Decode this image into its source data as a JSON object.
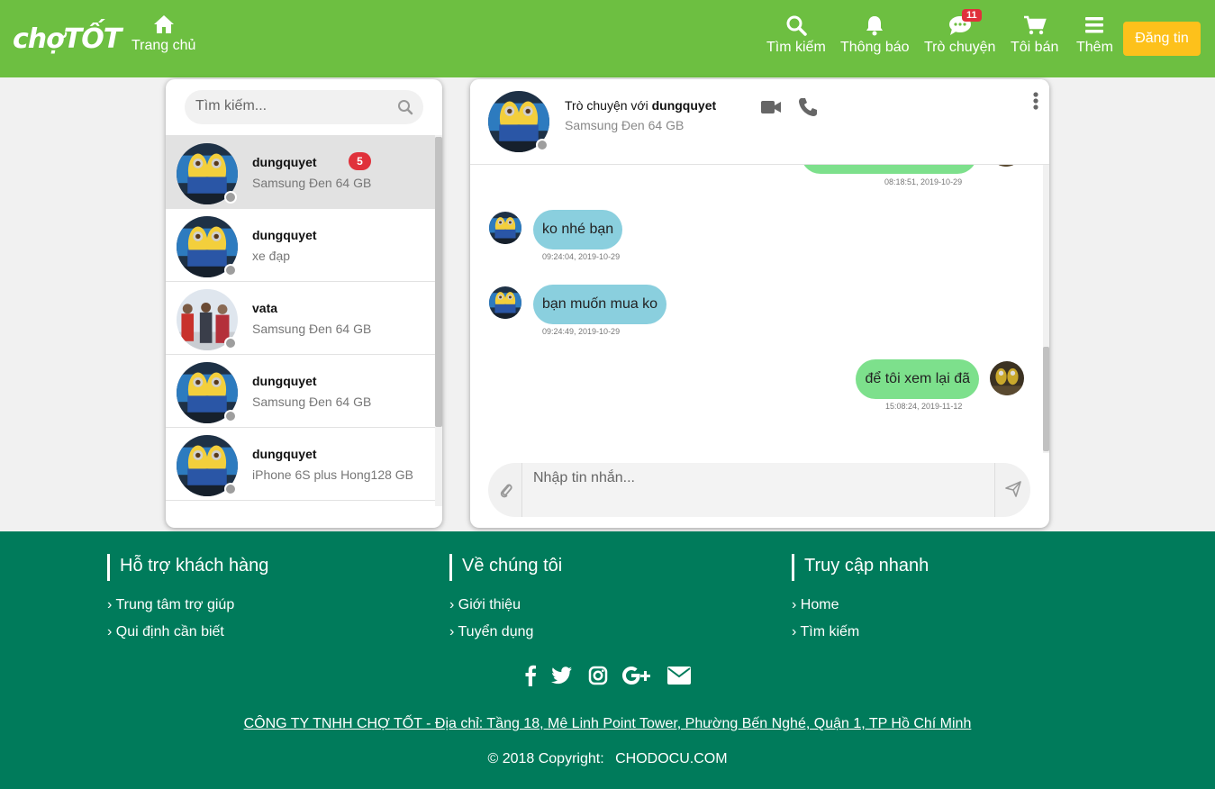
{
  "header": {
    "logo": "chợTỐT",
    "nav": {
      "home": "Trang chủ",
      "search": "Tìm kiếm",
      "notify": "Thông báo",
      "chat": "Trò chuyện",
      "chat_badge": "11",
      "sell": "Tôi bán",
      "more": "Thêm"
    },
    "post_button": "Đăng tin"
  },
  "sidebar": {
    "search_placeholder": "Tìm kiếm...",
    "conversations": [
      {
        "name": "dungquyet",
        "product": "Samsung Đen 64 GB",
        "unread": "5"
      },
      {
        "name": "dungquyet",
        "product": "xe đạp"
      },
      {
        "name": "vata",
        "product": "Samsung Đen 64 GB"
      },
      {
        "name": "dungquyet",
        "product": "Samsung Đen 64 GB"
      },
      {
        "name": "dungquyet",
        "product": "iPhone 6S plus Hong128 GB"
      }
    ]
  },
  "chat": {
    "with_prefix": "Trò chuyện với",
    "with_user": "dungquyet",
    "product": "Samsung Đen 64 GB",
    "messages": [
      {
        "direction": "out",
        "text": "",
        "time": "08:18:51, 2019-10-29"
      },
      {
        "direction": "in",
        "text": "ko nhé bạn",
        "time": "09:24:04, 2019-10-29"
      },
      {
        "direction": "in",
        "text": "bạn muốn mua ko",
        "time": "09:24:49, 2019-10-29"
      },
      {
        "direction": "out",
        "text": "để tôi xem lại đã",
        "time": "15:08:24, 2019-11-12"
      }
    ],
    "input_placeholder": "Nhập tin nhắn..."
  },
  "footer": {
    "columns": [
      {
        "title": "Hỗ trợ khách hàng",
        "links": [
          "Trung tâm trợ giúp",
          "Qui định cần biết"
        ]
      },
      {
        "title": "Về chúng tôi",
        "links": [
          "Giới thiệu",
          "Tuyển dụng"
        ]
      },
      {
        "title": "Truy cập nhanh",
        "links": [
          "Home",
          "Tìm kiếm"
        ]
      }
    ],
    "link_prefix": "›",
    "address": "CÔNG TY TNHH CHỢ TỐT - Địa chỉ: Tầng 18, Mê Linh Point Tower, Phường Bến Nghé, Quận 1, TP Hồ Chí Minh",
    "copyright": "© 2018 Copyright:",
    "brand": "CHODOCU.COM"
  },
  "colors": {
    "header": "#6dbf41",
    "post_button": "#fdc11b",
    "footer": "#007b5b",
    "incoming": "#8acfde",
    "outgoing": "#7de08c",
    "badge": "#e0313b"
  },
  "icons": [
    "home-icon",
    "search-icon",
    "bell-icon",
    "chat-icon",
    "cart-icon",
    "menu-icon",
    "video-icon",
    "phone-icon",
    "more-vertical-icon",
    "paperclip-icon",
    "send-icon",
    "facebook-icon",
    "twitter-icon",
    "instagram-icon",
    "google-plus-icon",
    "envelope-icon"
  ]
}
